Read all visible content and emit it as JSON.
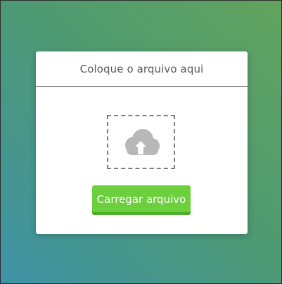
{
  "card": {
    "title": "Coloque o arquivo aqui"
  },
  "drop_zone": {
    "icon": "cloud-upload-icon"
  },
  "actions": {
    "upload_label": "Carregar arquivo"
  },
  "colors": {
    "background_gradient_top_right": "#62a35d",
    "background_gradient_bottom_left": "#3f93a7",
    "button": "#6ccf3c",
    "button_shadow": "#4caf2d",
    "icon": "#b8b8b8"
  }
}
